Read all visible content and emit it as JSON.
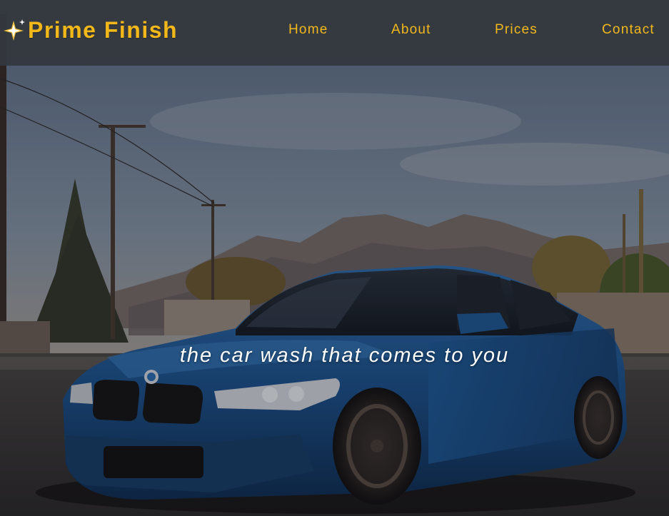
{
  "brand": {
    "name": "Prime Finish",
    "icon": "sparkle-star-icon",
    "color": "#f2b81a"
  },
  "nav": {
    "items": [
      {
        "label": "Home"
      },
      {
        "label": "About"
      },
      {
        "label": "Prices"
      },
      {
        "label": "Contact"
      }
    ],
    "link_color": "#f2b81a",
    "bar_color": "#34383e"
  },
  "hero": {
    "image": "blue-sedan-car-photo",
    "tagline": "the car wash that comes to you"
  }
}
